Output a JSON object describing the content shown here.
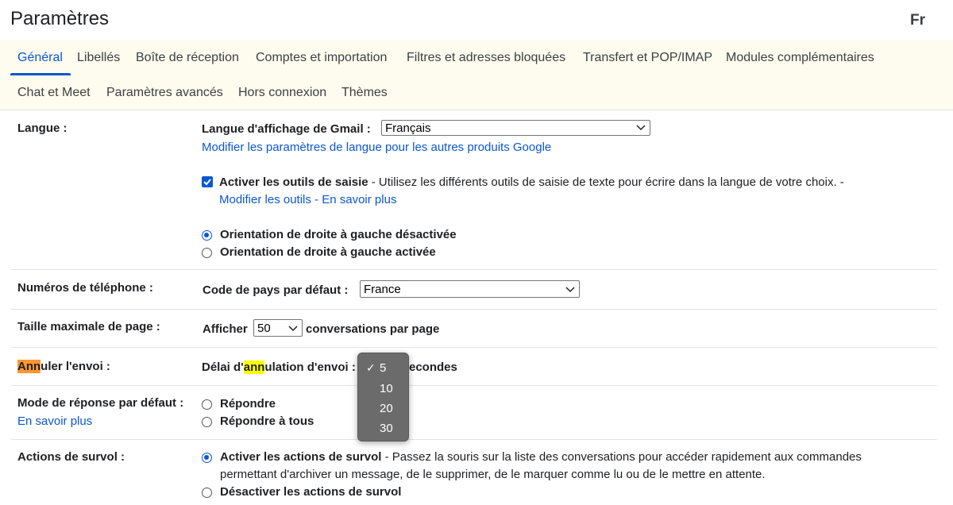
{
  "header": {
    "title": "Paramètres",
    "language_mark": "Fr"
  },
  "tabs": {
    "row1": [
      "Général",
      "Libellés",
      "Boîte de réception",
      "Comptes et importation",
      "Filtres et adresses bloquées",
      "Transfert et POP/IMAP",
      "Modules complémentaires"
    ],
    "row2": [
      "Chat et Meet",
      "Paramètres avancés",
      "Hors connexion",
      "Thèmes"
    ],
    "active": "Général"
  },
  "settings": {
    "language": {
      "label": "Langue :",
      "display_label": "Langue d'affichage de Gmail :",
      "display_value": "Français",
      "other_products_link": "Modifier les paramètres de langue pour les autres produits Google",
      "input_tools_label": "Activer les outils de saisie",
      "input_tools_desc": " - Utilisez les différents outils de saisie de texte pour écrire dans la langue de votre choix. -",
      "input_tools_checked": true,
      "edit_tools_link": "Modifier les outils",
      "link_separator": " - ",
      "learn_more_link": "En savoir plus",
      "rtl_off_label": "Orientation de droite à gauche désactivée",
      "rtl_on_label": "Orientation de droite à gauche activée"
    },
    "phone": {
      "label": "Numéros de téléphone :",
      "country_label": "Code de pays par défaut :",
      "country_value": "France"
    },
    "page_size": {
      "label": "Taille maximale de page :",
      "show_label": "Afficher",
      "value": "50",
      "suffix": "conversations par page"
    },
    "undo_send": {
      "label_highlight": "Ann",
      "label_rest": "uler l'envoi :",
      "delay_prefix": "Délai d'",
      "delay_highlight": "ann",
      "delay_rest": "ulation d'envoi :",
      "seconds_visible": "econdes",
      "options": [
        "5",
        "10",
        "20",
        "30"
      ],
      "selected": "5",
      "check_mark": "✓"
    },
    "reply_mode": {
      "label": "Mode de réponse par défaut :",
      "learn_more_link": "En savoir plus",
      "reply_label": "Répondre",
      "reply_all_label": "Répondre à tous"
    },
    "hover": {
      "label": "Actions de survol :",
      "enable_label": "Activer les actions de survol",
      "enable_desc": " - Passez la souris sur la liste des conversations pour accéder rapidement aux commandes",
      "enable_desc_2": "permettant d'archiver un message, de le supprimer, de le marquer comme lu ou de le mettre en attente.",
      "disable_label": "Désactiver les actions de survol"
    }
  },
  "colors": {
    "accent": "#0b57d0",
    "tabbar_bg": "#fdfcee",
    "highlight_orange": "#ff9632",
    "highlight_yellow": "#ffff00"
  },
  "icons": {
    "chevron": "chevron-down-icon",
    "checkbox": "checkmark-icon"
  }
}
